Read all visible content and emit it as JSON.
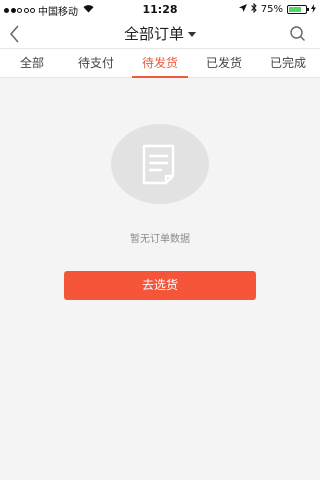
{
  "status_bar": {
    "carrier": "中国移动",
    "time": "11:28",
    "battery": "75%",
    "battery_level": 0.75
  },
  "nav": {
    "title": "全部订单"
  },
  "tabs": [
    {
      "label": "全部",
      "active": false
    },
    {
      "label": "待支付",
      "active": false
    },
    {
      "label": "待发货",
      "active": true
    },
    {
      "label": "已发货",
      "active": false
    },
    {
      "label": "已完成",
      "active": false
    }
  ],
  "empty_state": {
    "icon": "document-icon",
    "message": "暂无订单数据",
    "button_label": "去选货"
  },
  "colors": {
    "accent": "#f05a3c",
    "button": "#f5563a",
    "battery": "#4cd964"
  }
}
